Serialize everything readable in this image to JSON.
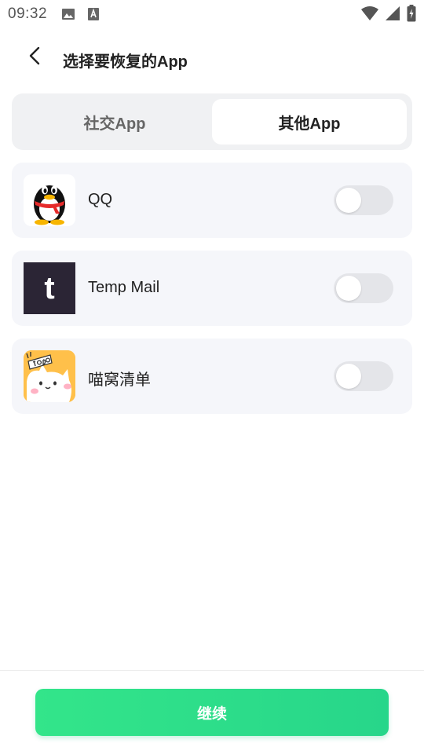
{
  "status_bar": {
    "time": "09:32",
    "icons_left": [
      "image-icon",
      "font-icon"
    ],
    "icons_right": [
      "wifi-icon",
      "signal-icon",
      "battery-icon"
    ]
  },
  "header": {
    "title": "选择要恢复的App",
    "back_icon": "chevron-left-icon"
  },
  "tabs": [
    {
      "label": "社交App",
      "active": false
    },
    {
      "label": "其他App",
      "active": true
    }
  ],
  "apps": [
    {
      "name": "QQ",
      "icon": "qq-penguin-icon",
      "enabled": false
    },
    {
      "name": "Temp Mail",
      "icon": "temp-mail-icon",
      "icon_letter": "t",
      "enabled": false
    },
    {
      "name": "喵窝清单",
      "icon": "cat-todo-icon",
      "enabled": false
    }
  ],
  "footer": {
    "continue_label": "继续"
  },
  "colors": {
    "accent_green": "#2ddc8a",
    "card_bg": "#f5f6fa",
    "tab_bg": "#f0f1f3",
    "toggle_off": "#e4e5e9",
    "temp_mail_bg": "#2b2535",
    "cat_icon_bg": "#ffc04a"
  }
}
